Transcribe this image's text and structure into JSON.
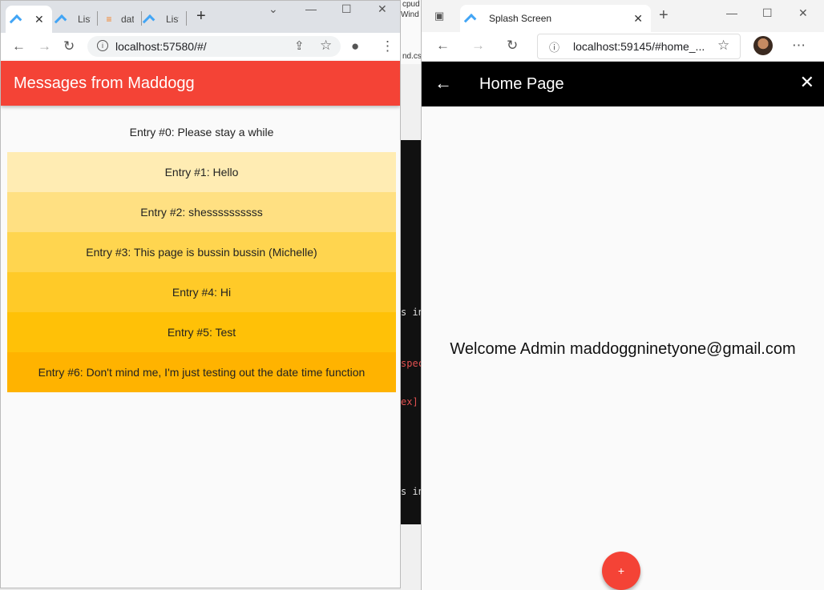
{
  "chrome": {
    "tabs": [
      {
        "label": "",
        "active": true
      },
      {
        "label": "List"
      },
      {
        "label": "dat"
      },
      {
        "label": "List"
      }
    ],
    "url": "localhost:57580/#/",
    "app_title": "Messages from Maddogg",
    "entries": [
      {
        "text": "Entry #0: Please stay a while",
        "color": "#fafafa"
      },
      {
        "text": "Entry #1: Hello",
        "color": "#ffecb3"
      },
      {
        "text": "Entry #2: shessssssssss",
        "color": "#ffe082"
      },
      {
        "text": "Entry #3: This page is bussin bussin (Michelle)",
        "color": "#ffd54f"
      },
      {
        "text": "Entry #4: Hi",
        "color": "#ffca28"
      },
      {
        "text": "Entry #5: Test",
        "color": "#ffc107"
      },
      {
        "text": "Entry #6: Don't mind me, I'm just testing out the date time function",
        "color": "#ffb300"
      }
    ],
    "appbar_color": "#f44336"
  },
  "edge": {
    "tab_title": "Splash Screen",
    "url": "localhost:59145/#home_...",
    "page_title": "Home Page",
    "welcome_text": "Welcome Admin maddoggninetyone@gmail.com",
    "fab_label": "+",
    "appbar_color": "#000000",
    "fab_color": "#f44336"
  },
  "background": {
    "fragments": [
      "cpud",
      "Wind",
      "nd.cs"
    ],
    "terminal_lines": [
      "s in",
      "spec",
      "ex]",
      "s in"
    ]
  }
}
